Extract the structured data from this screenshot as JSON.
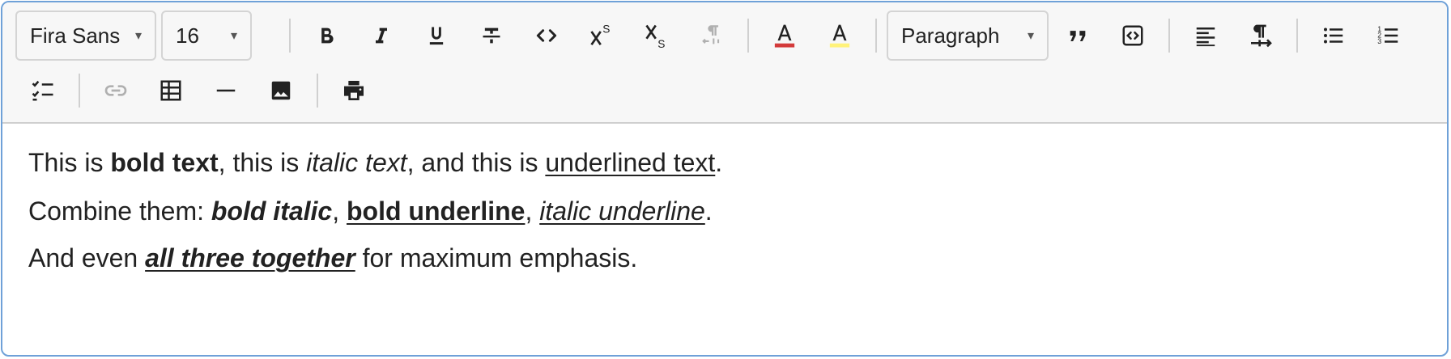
{
  "toolbar": {
    "font_family": {
      "value": "Fira Sans",
      "caret": "▾"
    },
    "font_size": {
      "value": "16",
      "caret": "▾"
    },
    "block_format": {
      "value": "Paragraph",
      "caret": "▾"
    },
    "buttons": {
      "bold": "bold-icon",
      "italic": "italic-icon",
      "underline": "underline-icon",
      "strikethrough": "strikethrough-icon",
      "code": "code-icon",
      "superscript": "superscript-icon",
      "subscript": "subscript-icon",
      "text_direction": "text-direction-icon",
      "text_color": "text-color-icon",
      "highlight": "highlight-icon",
      "blockquote": "blockquote-icon",
      "code_block": "code-block-icon",
      "align": "align-left-icon",
      "paragraph_direction": "paragraph-ltr-icon",
      "bullet_list": "bullet-list-icon",
      "numbered_list": "numbered-list-icon",
      "checklist": "checklist-icon",
      "link": "link-icon",
      "table": "table-icon",
      "horizontal_rule": "horizontal-rule-icon",
      "image": "image-icon",
      "print": "print-icon"
    },
    "colors": {
      "text_color": "#d33a3a",
      "highlight": "#fff27a",
      "disabled": "#b0b0b0"
    }
  },
  "content": {
    "p1": {
      "t1": "This is ",
      "t2": "bold text",
      "t3": ", this is ",
      "t4": "italic text",
      "t5": ", and this is ",
      "t6": "underlined text",
      "t7": "."
    },
    "p2": {
      "t1": "Combine them: ",
      "t2": "bold italic",
      "t3": ", ",
      "t4": "bold underline",
      "t5": ", ",
      "t6": "italic underline",
      "t7": "."
    },
    "p3": {
      "t1": "And even ",
      "t2": "all three together",
      "t3": " for maximum emphasis."
    }
  }
}
